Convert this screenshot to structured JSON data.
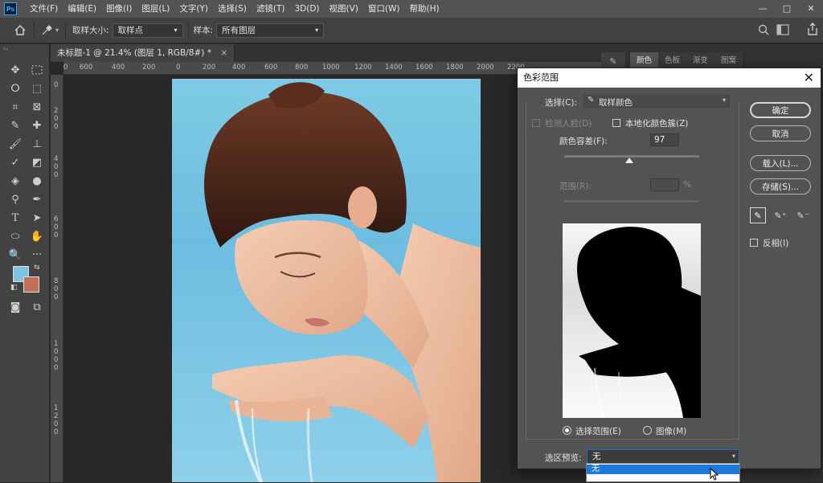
{
  "app": {
    "logo": "Ps"
  },
  "menu": [
    "文件(F)",
    "编辑(E)",
    "图像(I)",
    "图层(L)",
    "文字(Y)",
    "选择(S)",
    "滤镜(T)",
    "3D(D)",
    "视图(V)",
    "窗口(W)",
    "帮助(H)"
  ],
  "window_controls": [
    "—",
    "□",
    "✕"
  ],
  "options_bar": {
    "sample_size_label": "取样大小:",
    "sample_size_value": "取样点",
    "sample_label": "样本:",
    "sample_value": "所有图层"
  },
  "document": {
    "tab_title": "未标题-1 @ 21.4% (图层 1, RGB/8#) *",
    "ruler_h": [
      "0",
      "600",
      "400",
      "200",
      "0",
      "200",
      "400",
      "600",
      "800",
      "1000",
      "1200",
      "1400",
      "1600",
      "1800",
      "2000",
      "2200"
    ],
    "ruler_v": [
      "0",
      "2",
      "0",
      "0",
      "4",
      "0",
      "0",
      "6",
      "0",
      "0",
      "8",
      "0",
      "0",
      "1",
      "0",
      "0",
      "0",
      "1",
      "2",
      "0",
      "0"
    ]
  },
  "right_panel": {
    "tabs": [
      "颜色",
      "色板",
      "渐变",
      "图案"
    ],
    "active_tab": "颜色"
  },
  "colors": {
    "foreground": "#7fc3e2",
    "background": "#c07058"
  },
  "dialog": {
    "title": "色彩范围",
    "select_label": "选择(C):",
    "select_value": "取样颜色",
    "detect_faces_label": "检测人脸(D)",
    "localized_label": "本地化颜色簇(Z)",
    "fuzziness_label": "颜色容差(F):",
    "fuzziness_value": "97",
    "range_label": "范围(R):",
    "range_unit": "%",
    "ok_label": "确定",
    "cancel_label": "取消",
    "load_label": "载入(L)...",
    "save_label": "存储(S)...",
    "invert_label": "反相(I)",
    "radio_selection_label": "选择范围(E)",
    "radio_image_label": "图像(M)",
    "selection_preview_label": "选区预览:",
    "selection_preview_value": "无",
    "dropdown_option": "无"
  }
}
